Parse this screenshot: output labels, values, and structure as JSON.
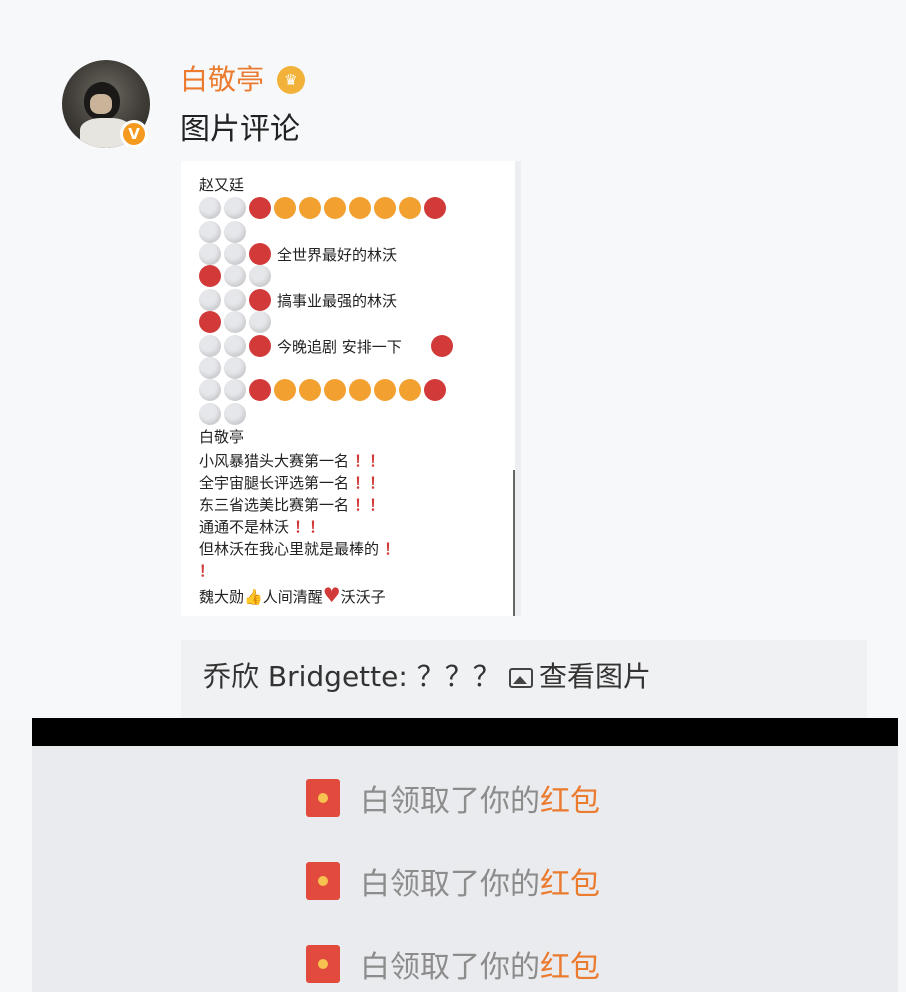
{
  "post": {
    "username": "白敬亭",
    "text": "图片评论",
    "badge": "V"
  },
  "comment_image": {
    "user1": "赵又廷",
    "line1": "全世界最好的林沃",
    "line2": "搞事业最强的林沃",
    "line3": "今晚追剧 安排一下",
    "user2": "白敬亭",
    "rows": [
      "小风暴猎头大赛第一名",
      "全宇宙腿长评选第一名",
      "东三省选美比赛第一名",
      "通通不是林沃",
      "但林沃在我心里就是最棒的"
    ],
    "last_a": "魏大勋",
    "last_b": "人间清醒",
    "last_c": "沃沃子"
  },
  "reply": {
    "name_text": "乔欣 Bridgette: ？？？",
    "view_link": "查看图片"
  },
  "notices": [
    {
      "text": "白领取了你的",
      "link": "红包"
    },
    {
      "text": "白领取了你的",
      "link": "红包"
    },
    {
      "text": "白领取了你的",
      "link": "红包"
    }
  ],
  "icons": [
    "avatar",
    "verified-badge-icon",
    "crown-icon",
    "picture-icon",
    "red-packet-icon"
  ],
  "colors": {
    "accent": "#eb7b2f",
    "red_packet": "#e14a3c"
  }
}
